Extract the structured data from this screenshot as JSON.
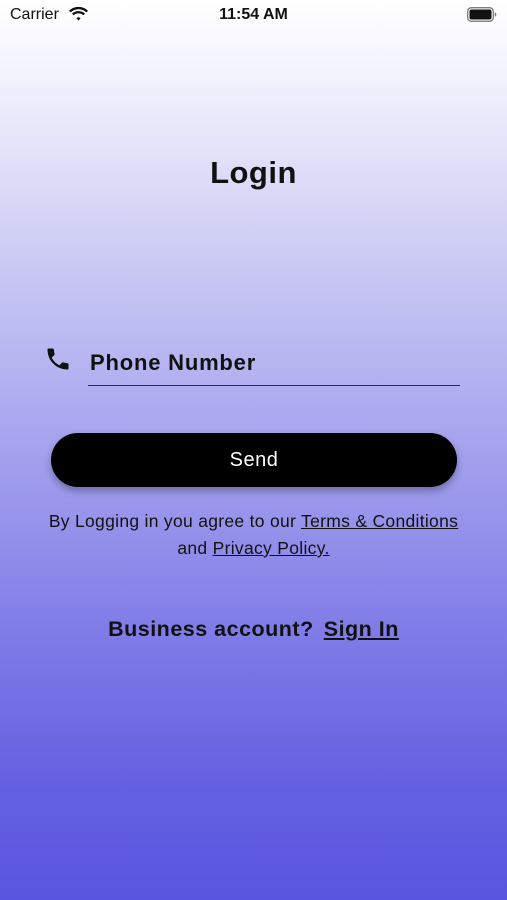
{
  "status_bar": {
    "carrier": "Carrier",
    "time": "11:54 AM",
    "icons": [
      "wifi-icon",
      "battery-icon"
    ]
  },
  "login": {
    "title": "Login",
    "phone_icon": "phone-icon",
    "phone_placeholder": "Phone Number",
    "phone_value": "",
    "send_label": "Send"
  },
  "terms": {
    "prefix": "By Logging in you agree to our",
    "terms_link": "Terms & Conditions",
    "conjunction": "and",
    "privacy_link": "Privacy Policy."
  },
  "business": {
    "prompt": "Business account?",
    "sign_in_link": "Sign In"
  },
  "colors": {
    "gradient_top": "#ffffff",
    "gradient_bottom": "#5a55e0",
    "button_bg": "#000000",
    "button_text": "#ffffff",
    "text": "#111111"
  }
}
